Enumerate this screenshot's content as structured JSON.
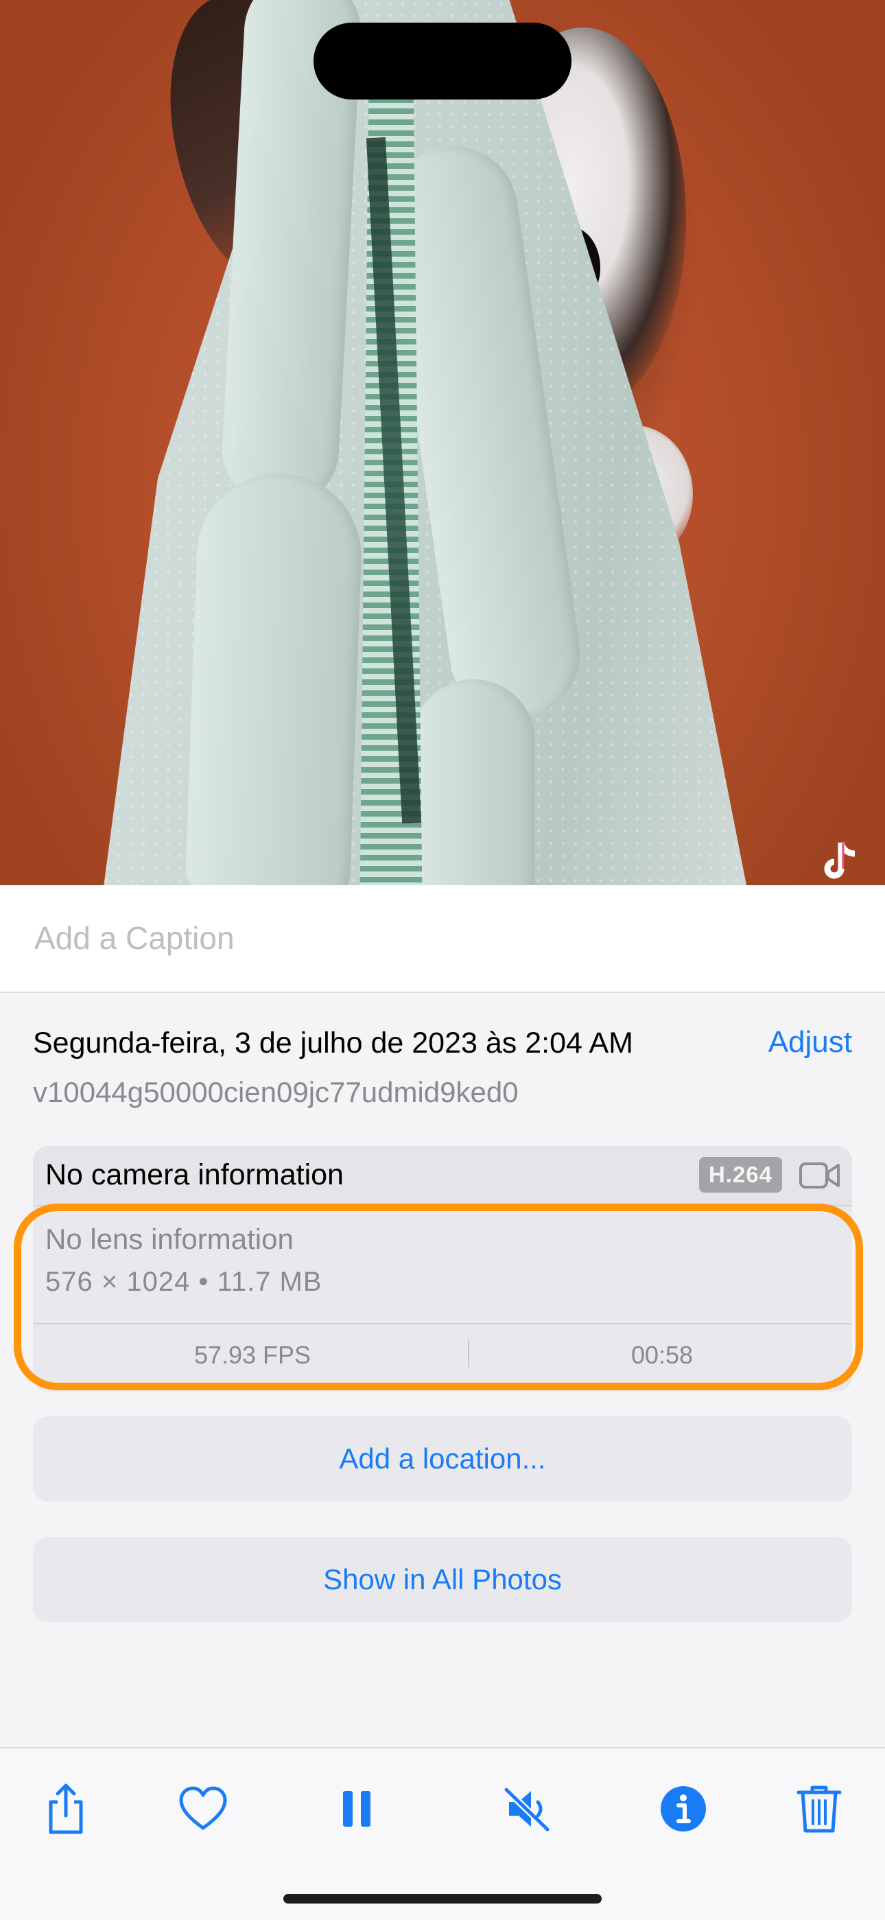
{
  "caption": {
    "placeholder": "Add a Caption"
  },
  "details": {
    "date_time": "Segunda-feira, 3 de julho de 2023 às 2:04 AM",
    "adjust_label": "Adjust",
    "filename": "v10044g50000cien09jc77udmid9ked0"
  },
  "media_info": {
    "camera": "No camera information",
    "codec_badge": "H.264",
    "lens": "No lens information",
    "resolution_size": "576 × 1024  •  11.7 MB",
    "fps": "57.93 FPS",
    "duration": "00:58"
  },
  "actions": {
    "add_location": "Add a location...",
    "show_all_photos": "Show in All Photos"
  },
  "toolbar": {
    "icons": [
      "share-icon",
      "heart-icon",
      "pause-icon",
      "mute-icon",
      "info-icon",
      "trash-icon"
    ]
  },
  "colors": {
    "accent": "#1a7cf5",
    "highlight": "#ff950c",
    "secondary_text": "#8a8a8e"
  }
}
